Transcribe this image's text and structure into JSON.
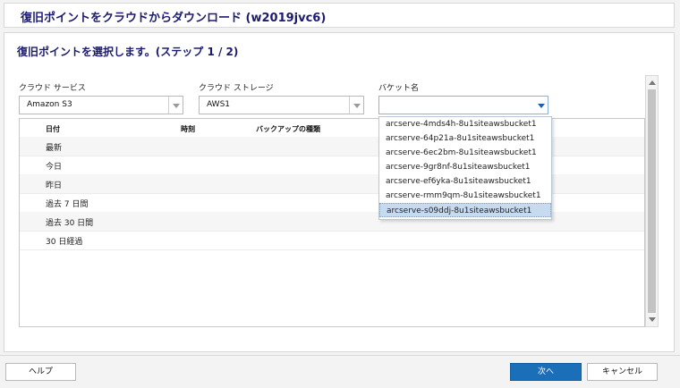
{
  "window": {
    "title": "復旧ポイントをクラウドからダウンロード (w2019jvc6)"
  },
  "step": {
    "title": "復旧ポイントを選択します。(ステップ 1 / 2)"
  },
  "fields": {
    "cloud_service": {
      "label": "クラウド サービス",
      "value": "Amazon S3"
    },
    "cloud_storage": {
      "label": "クラウド ストレージ",
      "value": "AWS1"
    },
    "bucket": {
      "label": "バケット名",
      "value": ""
    }
  },
  "grid": {
    "columns": [
      "日付",
      "時刻",
      "バックアップの種類"
    ],
    "rows": [
      "最新",
      "今日",
      "昨日",
      "過去 7 日間",
      "過去 30 日間",
      "30 日経過"
    ]
  },
  "bucket_options": {
    "items": [
      "arcserve-4mds4h-8u1siteawsbucket1",
      "arcserve-64p21a-8u1siteawsbucket1",
      "arcserve-6ec2bm-8u1siteawsbucket1",
      "arcserve-9gr8nf-8u1siteawsbucket1",
      "arcserve-ef6yka-8u1siteawsbucket1",
      "arcserve-rmm9qm-8u1siteawsbucket1",
      "arcserve-s09ddj-8u1siteawsbucket1"
    ],
    "selected_index": 6
  },
  "footer": {
    "help": "ヘルプ",
    "next": "次へ",
    "cancel": "キャンセル"
  },
  "colors": {
    "title": "#1b1b70",
    "primary_button": "#1b6fb8",
    "selected_item": "#c7dbf0"
  }
}
